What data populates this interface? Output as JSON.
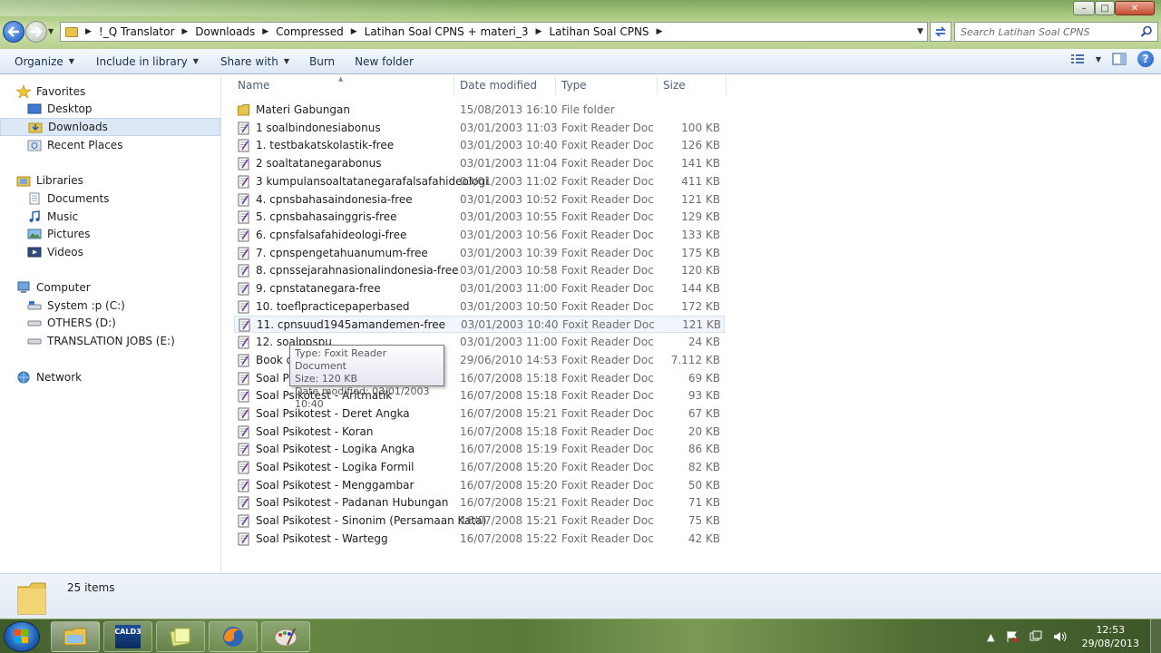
{
  "window": {
    "min_glyph": "–",
    "max_glyph": "□",
    "close_glyph": "✕"
  },
  "breadcrumb": [
    "!_Q Translator",
    "Downloads",
    "Compressed",
    "Latihan Soal CPNS + materi_3",
    "Latihan Soal CPNS"
  ],
  "search": {
    "placeholder": "Search Latihan Soal CPNS"
  },
  "toolbar": {
    "organize": "Organize",
    "include": "Include in library",
    "share": "Share with",
    "burn": "Burn",
    "new_folder": "New folder"
  },
  "nav": {
    "favorites": "Favorites",
    "desktop": "Desktop",
    "downloads": "Downloads",
    "recent": "Recent Places",
    "libraries": "Libraries",
    "documents": "Documents",
    "music": "Music",
    "pictures": "Pictures",
    "videos": "Videos",
    "computer": "Computer",
    "drive_c": "System :p (C:)",
    "drive_d": "OTHERS (D:)",
    "drive_e": "TRANSLATION JOBS (E:)",
    "network": "Network"
  },
  "columns": {
    "name": "Name",
    "date": "Date modified",
    "type": "Type",
    "size": "Size"
  },
  "files": [
    {
      "name": "Materi Gabungan",
      "date": "15/08/2013 16:10",
      "type": "File folder",
      "size": ""
    },
    {
      "name": "1 soalbindonesiabonus",
      "date": "03/01/2003 11:03",
      "type": "Foxit Reader Docu...",
      "size": "100 KB"
    },
    {
      "name": "1. testbakatskolastik-free",
      "date": "03/01/2003 10:40",
      "type": "Foxit Reader Docu...",
      "size": "126 KB"
    },
    {
      "name": "2 soaltatanegarabonus",
      "date": "03/01/2003 11:04",
      "type": "Foxit Reader Docu...",
      "size": "141 KB"
    },
    {
      "name": "3 kumpulansoaltatanegarafalsafahideologi",
      "date": "03/01/2003 11:02",
      "type": "Foxit Reader Docu...",
      "size": "411 KB"
    },
    {
      "name": "4. cpnsbahasaindonesia-free",
      "date": "03/01/2003 10:52",
      "type": "Foxit Reader Docu...",
      "size": "121 KB"
    },
    {
      "name": "5. cpnsbahasainggris-free",
      "date": "03/01/2003 10:55",
      "type": "Foxit Reader Docu...",
      "size": "129 KB"
    },
    {
      "name": "6. cpnsfalsafahideologi-free",
      "date": "03/01/2003 10:56",
      "type": "Foxit Reader Docu...",
      "size": "133 KB"
    },
    {
      "name": "7. cpnspengetahuanumum-free",
      "date": "03/01/2003 10:39",
      "type": "Foxit Reader Docu...",
      "size": "175 KB"
    },
    {
      "name": "8. cpnssejarahnasionalindonesia-free",
      "date": "03/01/2003 10:58",
      "type": "Foxit Reader Docu...",
      "size": "120 KB"
    },
    {
      "name": "9. cpnstatanegara-free",
      "date": "03/01/2003 11:00",
      "type": "Foxit Reader Docu...",
      "size": "144 KB"
    },
    {
      "name": "10. toeflpracticepaperbased",
      "date": "03/01/2003 10:50",
      "type": "Foxit Reader Docu...",
      "size": "172 KB"
    },
    {
      "name": "11. cpnsuud1945amandemen-free",
      "date": "03/01/2003 10:40",
      "type": "Foxit Reader Docu...",
      "size": "121 KB"
    },
    {
      "name": "12. soalppspu",
      "date": "03/01/2003 11:00",
      "type": "Foxit Reader Docu...",
      "size": "24 KB"
    },
    {
      "name": "Book of",
      "date": "29/06/2010 14:53",
      "type": "Foxit Reader Docu...",
      "size": "7.112 KB"
    },
    {
      "name": "Soal Psi",
      "date": "16/07/2008 15:18",
      "type": "Foxit Reader Docu...",
      "size": "69 KB"
    },
    {
      "name": "Soal Psikotest - Aritmatik",
      "date": "16/07/2008 15:18",
      "type": "Foxit Reader Docu...",
      "size": "93 KB"
    },
    {
      "name": "Soal Psikotest - Deret Angka",
      "date": "16/07/2008 15:21",
      "type": "Foxit Reader Docu...",
      "size": "67 KB"
    },
    {
      "name": "Soal Psikotest - Koran",
      "date": "16/07/2008 15:18",
      "type": "Foxit Reader Docu...",
      "size": "20 KB"
    },
    {
      "name": "Soal Psikotest - Logika Angka",
      "date": "16/07/2008 15:19",
      "type": "Foxit Reader Docu...",
      "size": "86 KB"
    },
    {
      "name": "Soal Psikotest - Logika Formil",
      "date": "16/07/2008 15:20",
      "type": "Foxit Reader Docu...",
      "size": "82 KB"
    },
    {
      "name": "Soal Psikotest - Menggambar",
      "date": "16/07/2008 15:20",
      "type": "Foxit Reader Docu...",
      "size": "50 KB"
    },
    {
      "name": "Soal Psikotest - Padanan Hubungan",
      "date": "16/07/2008 15:21",
      "type": "Foxit Reader Docu...",
      "size": "71 KB"
    },
    {
      "name": "Soal Psikotest - Sinonim (Persamaan Kata)",
      "date": "16/07/2008 15:21",
      "type": "Foxit Reader Docu...",
      "size": "75 KB"
    },
    {
      "name": "Soal Psikotest - Wartegg",
      "date": "16/07/2008 15:22",
      "type": "Foxit Reader Docu...",
      "size": "42 KB"
    }
  ],
  "tooltip": {
    "type": "Type: Foxit Reader Document",
    "size": "Size: 120 KB",
    "date": "Date modified: 03/01/2003 10:40"
  },
  "details": {
    "count": "25 items"
  },
  "taskbar": {
    "cald_label": "CALD3",
    "time": "12:53",
    "date": "29/08/2013"
  },
  "colors": {
    "selection": "#dde8f6",
    "link_blue": "#1b2f4d",
    "folder_yellow": "#e7c450"
  }
}
